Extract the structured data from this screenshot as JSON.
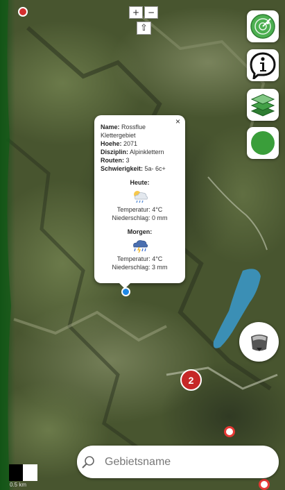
{
  "zoom": {
    "in_label": "+",
    "out_label": "−",
    "north_label": "⇧"
  },
  "buttons": {
    "radar_icon": "radar-icon",
    "info_icon": "info-icon",
    "layers_icon": "layers-icon",
    "status_color": "#3a9e3a"
  },
  "popup": {
    "close_label": "×",
    "fields": [
      {
        "key": "Name:",
        "value": " Rossflue"
      },
      {
        "key": "",
        "value": "Klettergebiet"
      },
      {
        "key": "Hoehe:",
        "value": " 2071"
      },
      {
        "key": "Disziplin:",
        "value": " Alpinklettern"
      },
      {
        "key": "Routen:",
        "value": " 3"
      },
      {
        "key": "Schwierigkeit:",
        "value": " 5a- 6c+"
      }
    ],
    "today": {
      "heading": "Heute:",
      "icon": "cloud-rain-icon",
      "temperature": "Temperatur: 4°C",
      "precipitation": "Niederschlag: 0 mm"
    },
    "tomorrow": {
      "heading": "Morgen:",
      "icon": "storm-rain-icon",
      "temperature": "Temperatur: 4°C",
      "precipitation": "Niederschlag: 3 mm"
    }
  },
  "cluster": {
    "count": "2",
    "color": "#c62828"
  },
  "search": {
    "placeholder": "Gebietsname"
  },
  "scale": {
    "label": "0.5 km"
  }
}
